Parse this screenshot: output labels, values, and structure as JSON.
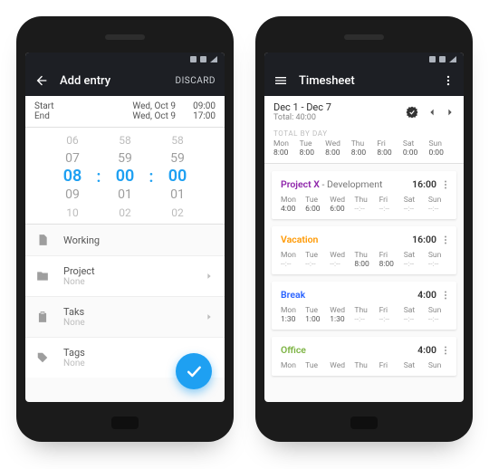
{
  "phone1": {
    "title": "Add entry",
    "discard": "DISCARD",
    "range": {
      "start_label": "Start",
      "end_label": "End",
      "start_date": "Wed, Oct 9",
      "start_time": "09:00",
      "end_date": "Wed, Oct 9",
      "end_time": "17:00"
    },
    "picker": {
      "col1": [
        "06",
        "07",
        "08",
        "09",
        "10"
      ],
      "col2": [
        "58",
        "59",
        "00",
        "01",
        "02"
      ],
      "col3": [
        "58",
        "59",
        "00",
        "01",
        "02"
      ],
      "colon": ":"
    },
    "rows": {
      "working": {
        "label": "Working"
      },
      "project": {
        "label": "Project",
        "value": "None"
      },
      "task": {
        "label": "Taks",
        "value": "None"
      },
      "tags": {
        "label": "Tags",
        "value": "None"
      }
    }
  },
  "phone2": {
    "title": "Timesheet",
    "range": "Dec 1 - Dec 7",
    "total_label": "Total: 40:00",
    "total_by_day_label": "TOTAL BY DAY",
    "day_names": [
      "Mon",
      "Tue",
      "Wed",
      "Thu",
      "Fri",
      "Sat",
      "Sun"
    ],
    "day_totals": [
      "8:00",
      "8:00",
      "8:00",
      "8:00",
      "8:00",
      "0:00",
      "0:00"
    ],
    "cards": [
      {
        "project": "Project X",
        "task": " - Development",
        "color": "#8e24aa",
        "hours": "16:00",
        "values": [
          "4:00",
          "6:00",
          "6:00",
          "--:--",
          "--:--",
          "--:--",
          "--:--"
        ]
      },
      {
        "project": "Vacation",
        "task": "",
        "color": "#ff9800",
        "hours": "16:00",
        "values": [
          "--:--",
          "--:--",
          "--:--",
          "8:00",
          "8:00",
          "--:--",
          "--:--"
        ]
      },
      {
        "project": "Break",
        "task": "",
        "color": "#2962ff",
        "hours": "4:00",
        "values": [
          "1:30",
          "1:00",
          "1:30",
          "--:--",
          "--:--",
          "--:--",
          "--:--"
        ]
      },
      {
        "project": "Office",
        "task": "",
        "color": "#7cb342",
        "hours": "4:00",
        "values": [
          "",
          "",
          "",
          "",
          "",
          "",
          ""
        ]
      }
    ]
  }
}
